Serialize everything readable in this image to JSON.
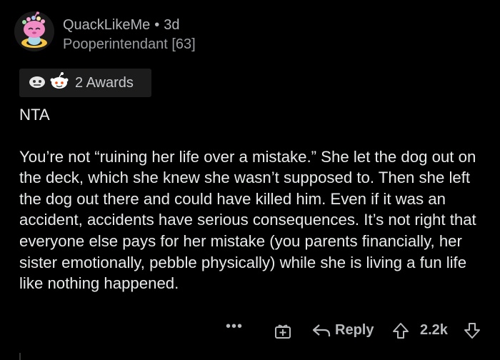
{
  "comment": {
    "username": "QuackLikeMe",
    "separator": "•",
    "age": "3d",
    "flair": "Pooperintendant [63]",
    "awards": {
      "count_label": "2 Awards",
      "icons": [
        "silver-award-icon",
        "wholesome-award-icon"
      ]
    },
    "body": {
      "verdict": "NTA",
      "paragraph": "You’re not “ruining her life over a mistake.”  She let the dog out on the deck, which she knew she wasn’t supposed to.  Then she left the dog out there and could have killed him.  Even if it was an accident, accidents have serious consequences.  It’s not right that everyone else pays for her mistake (you parents financially, her sister emotionally, pebble physically) while she is living a fun life like nothing happened."
    },
    "actions": {
      "more_label": "•••",
      "reply_label": "Reply",
      "score": "2.2k"
    }
  },
  "colors": {
    "background": "#000000",
    "meta_text": "#b3b7ba",
    "body_text": "#e8eaeb",
    "award_chip": "#1c1c1d"
  }
}
